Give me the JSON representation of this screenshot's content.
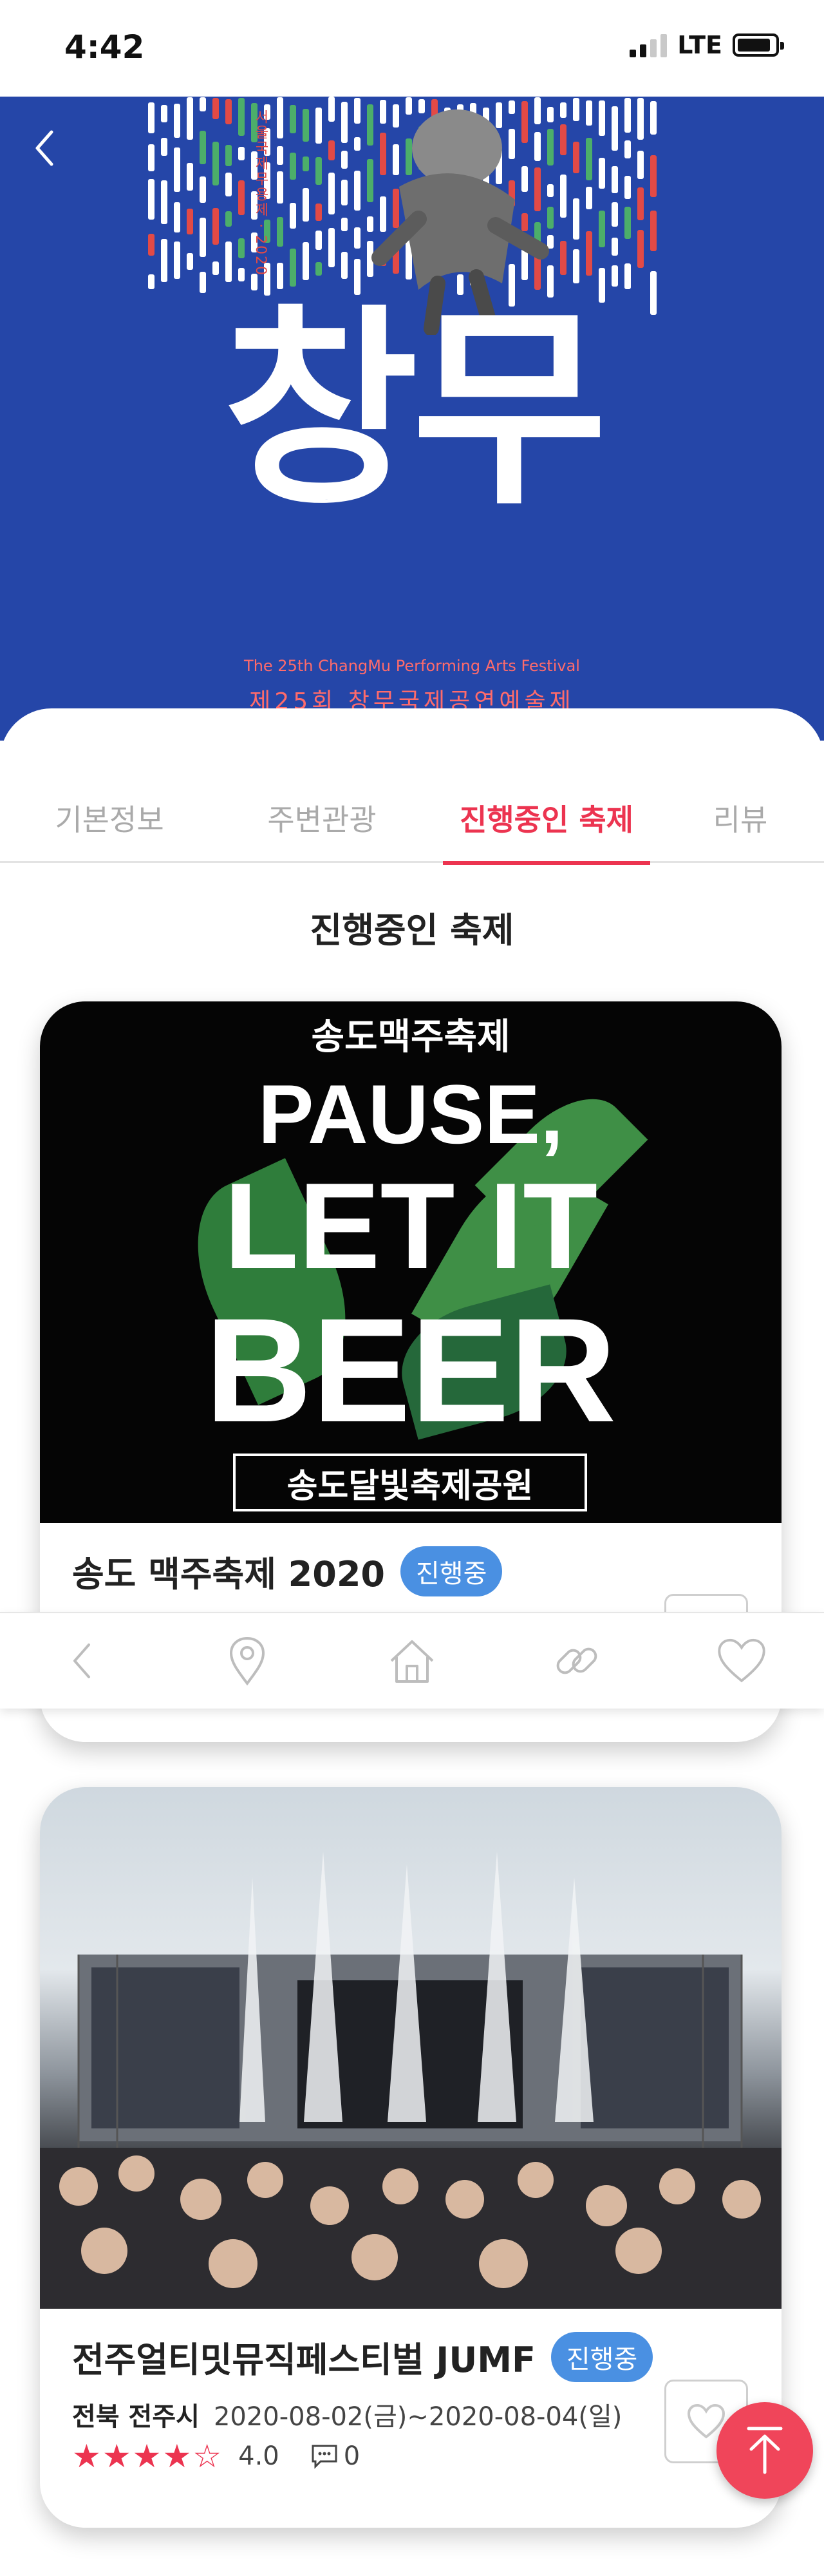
{
  "status_bar": {
    "time": "4:42",
    "network": "LTE"
  },
  "hero": {
    "title": "창무",
    "vertical_text": "서울국제무용제 · 2020",
    "subtitle": "The 25th ChangMu Performing Arts Festival",
    "subtitle_kr": "제25회 창무국제공연예술제"
  },
  "tabs": [
    {
      "label": "기본정보",
      "active": false
    },
    {
      "label": "주변관광",
      "active": false
    },
    {
      "label": "진행중인 축제",
      "active": true
    },
    {
      "label": "리뷰",
      "active": false
    }
  ],
  "section_title": "진행중인 축제",
  "festivals": [
    {
      "poster": {
        "top_label": "송도맥주축제",
        "line1": "PAUSE,",
        "line2": "LET IT",
        "line3": "BEER",
        "location_label": "송도달빛축제공원"
      },
      "name": "송도 맥주축제 2020",
      "status": "진행중"
    },
    {
      "name": "전주얼티밋뮤직페스티벌 JUMF",
      "status": "진행중",
      "region": "전북 전주시",
      "dates": "2020-08-02(금)~2020-08-04(일)",
      "stars": "★★★★☆",
      "rating": "4.0",
      "reviews": "0"
    }
  ],
  "colors": {
    "accent": "#ec3450",
    "badge": "#4a90e2",
    "hero_bg": "#2546a8"
  },
  "bottom_nav": [
    "back-icon",
    "location-pin-icon",
    "home-icon",
    "link-icon",
    "heart-icon"
  ]
}
